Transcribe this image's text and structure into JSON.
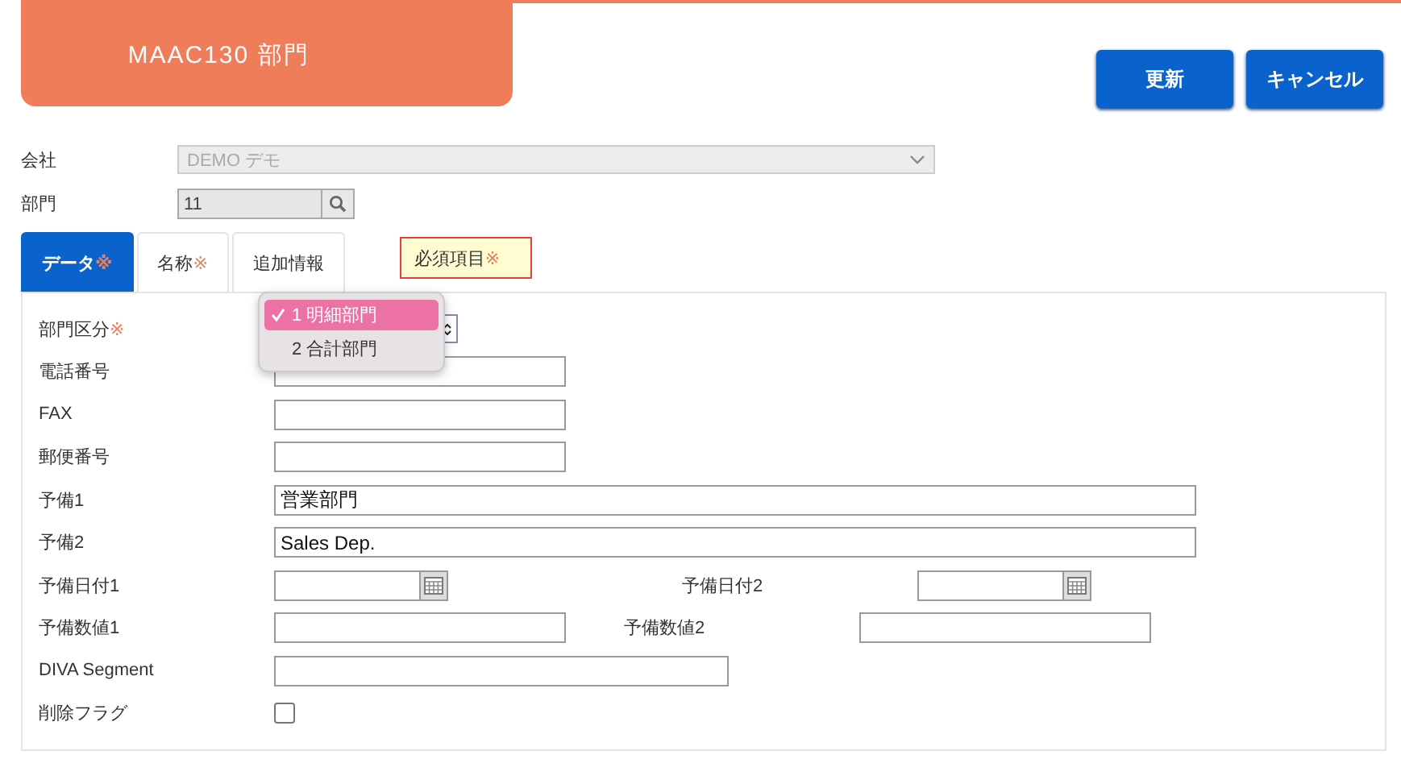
{
  "header": {
    "title": "MAAC130 部門"
  },
  "buttons": [
    {
      "label": "更新"
    },
    {
      "label": "キャンセル"
    }
  ],
  "top_fields": [
    {
      "label": "会社",
      "kind": "select",
      "value": "DEMO デモ",
      "disabled": true
    },
    {
      "label": "部門",
      "kind": "lookup",
      "value": "11",
      "disabled": true
    }
  ],
  "tabs": [
    {
      "label": "データ",
      "mark": "※",
      "selected": true
    },
    {
      "label": "名称",
      "mark": "※",
      "selected": false
    },
    {
      "label": "追加情報",
      "selected": false
    }
  ],
  "required_note": {
    "label": "必須項目",
    "mark": "※"
  },
  "rows": [
    {
      "fields": [
        {
          "label": "部門区分",
          "mark": "※",
          "kind": "select",
          "expanded": true,
          "options": [
            {
              "label": "1 明細部門",
              "selected": true
            },
            {
              "label": "2 合計部門",
              "selected": false
            }
          ]
        }
      ]
    },
    {
      "fields": [
        {
          "label": "電話番号",
          "kind": "short"
        }
      ]
    },
    {
      "fields": [
        {
          "label": "FAX",
          "kind": "short"
        }
      ]
    },
    {
      "fields": [
        {
          "label": "郵便番号",
          "kind": "short"
        }
      ]
    },
    {
      "fields": [
        {
          "label": "予備1",
          "kind": "long",
          "value": "営業部門"
        }
      ]
    },
    {
      "fields": [
        {
          "label": "予備2",
          "kind": "long",
          "value": "Sales Dep."
        }
      ]
    },
    {
      "fields": [
        {
          "label": "予備日付1",
          "kind": "date"
        },
        {
          "label": "予備日付2",
          "kind": "date"
        }
      ]
    },
    {
      "fields": [
        {
          "label": "予備数値1",
          "kind": "short"
        },
        {
          "label": "予備数値2",
          "kind": "short"
        }
      ]
    },
    {
      "fields": [
        {
          "label": "DIVA Segment",
          "kind": "medium"
        }
      ]
    },
    {
      "fields": [
        {
          "label": "削除フラグ",
          "kind": "checkbox",
          "checked": false
        }
      ]
    }
  ]
}
